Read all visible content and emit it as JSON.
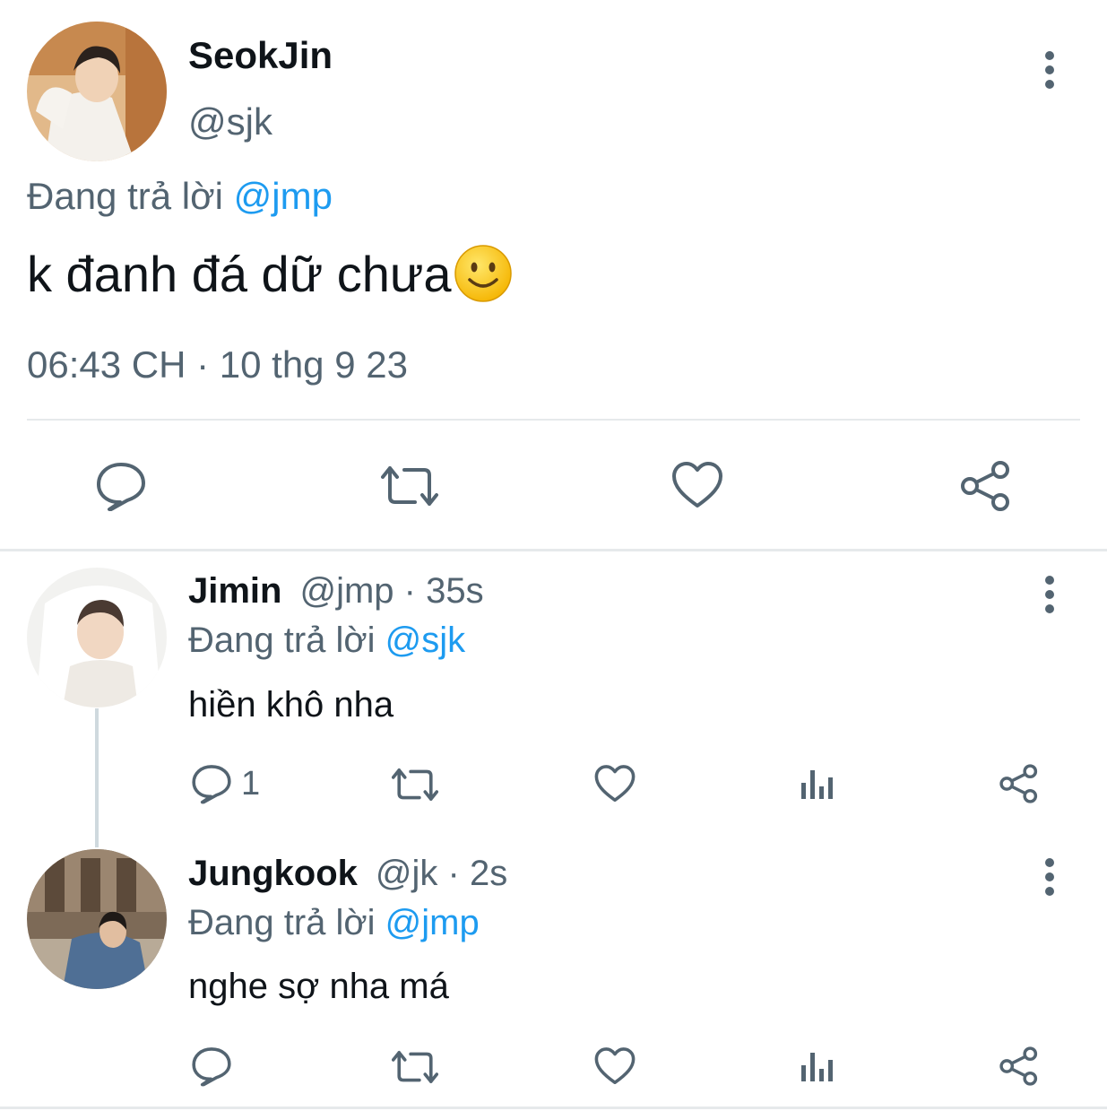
{
  "main_tweet": {
    "author_name": "SeokJin",
    "handle": "@sjk",
    "reply_prefix": "Đang trả lời",
    "reply_mention": "@jmp",
    "text": "k đanh đá dữ chưa",
    "emoji": "slightly-smiling-face",
    "timestamp": "06:43 CH · 10 thg 9 23",
    "actions": [
      "reply-icon",
      "retweet-icon",
      "like-icon",
      "share-icon"
    ]
  },
  "replies": [
    {
      "author_name": "Jimin",
      "handle_time": "@jmp · 35s",
      "reply_prefix": "Đang trả lời",
      "reply_mention": "@sjk",
      "text": "hiền khô nha",
      "reply_count": "1",
      "actions": [
        "reply-icon",
        "retweet-icon",
        "like-icon",
        "views-icon",
        "share-icon"
      ]
    },
    {
      "author_name": "Jungkook",
      "handle_time": "@jk · 2s",
      "reply_prefix": "Đang trả lời",
      "reply_mention": "@jmp",
      "text": "nghe sợ nha má",
      "reply_count": "",
      "actions": [
        "reply-icon",
        "retweet-icon",
        "like-icon",
        "views-icon",
        "share-icon"
      ]
    }
  ],
  "colors": {
    "text": "#0f1419",
    "secondary": "#536471",
    "mention": "#1d9bf0",
    "divider": "#e6e9eb",
    "thread_line": "#cfd9de"
  }
}
